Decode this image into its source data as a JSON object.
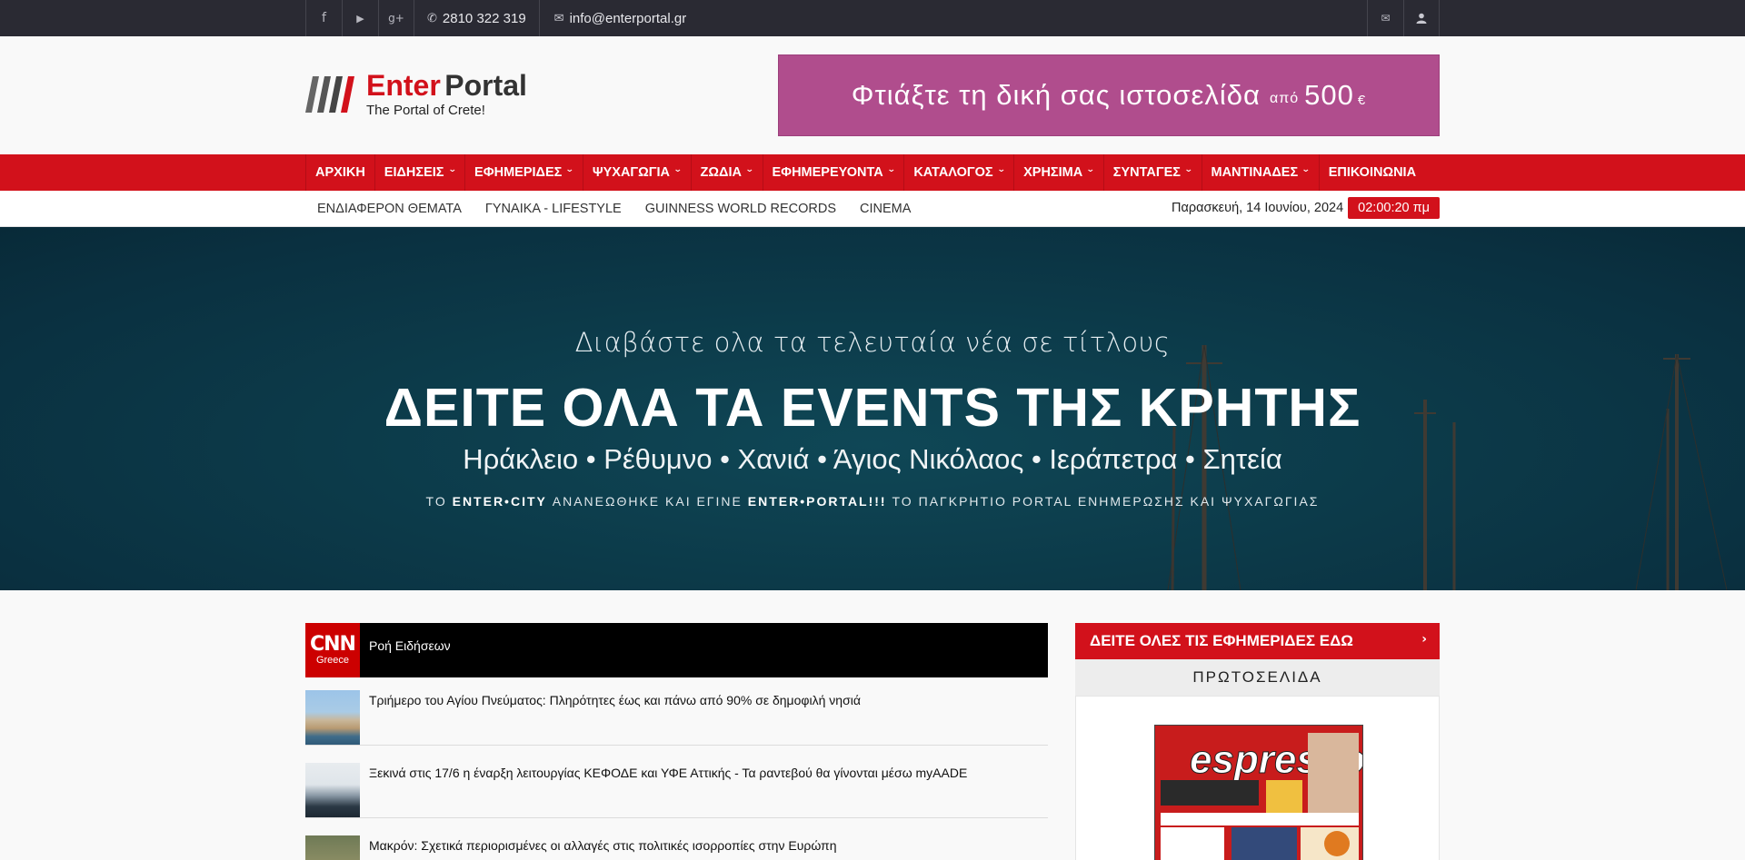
{
  "topbar": {
    "social_icons": [
      "facebook-icon",
      "youtube-icon",
      "google-plus-icon"
    ],
    "social_glyphs": [
      "f",
      "▶",
      "g+"
    ],
    "phone_glyph": "✆",
    "phone": "2810 322 319",
    "email_glyph": "✉",
    "email": "info@enterportal.gr",
    "right_icons": [
      "envelope-icon",
      "user-icon"
    ],
    "right_glyphs": [
      "✉",
      "👤"
    ]
  },
  "logo": {
    "enter": "Enter",
    "portal": "Portal",
    "tagline": "The Portal of Crete!"
  },
  "banner": {
    "text": "Φτιάξτε τη δική σας ιστοσελίδα",
    "from": "από",
    "price": "500",
    "currency": "€"
  },
  "mainnav": {
    "items": [
      {
        "label": "ΑΡΧΙΚΗ",
        "dropdown": false
      },
      {
        "label": "ΕΙΔΗΣΕΙΣ",
        "dropdown": true
      },
      {
        "label": "ΕΦΗΜΕΡΙΔΕΣ",
        "dropdown": true
      },
      {
        "label": "ΨΥΧΑΓΩΓΙΑ",
        "dropdown": true
      },
      {
        "label": "ΖΩΔΙΑ",
        "dropdown": true
      },
      {
        "label": "ΕΦΗΜΕΡΕΥΟΝΤΑ",
        "dropdown": true
      },
      {
        "label": "ΚΑΤΑΛΟΓΟΣ",
        "dropdown": true
      },
      {
        "label": "ΧΡΗΣΙΜΑ",
        "dropdown": true
      },
      {
        "label": "ΣΥΝΤΑΓΕΣ",
        "dropdown": true
      },
      {
        "label": "ΜΑΝΤΙΝΑΔΕΣ",
        "dropdown": true
      },
      {
        "label": "ΕΠΙΚΟΙΝΩΝΙΑ",
        "dropdown": false
      }
    ]
  },
  "subnav": {
    "items": [
      "ΕΝΔΙΑΦΕΡΟΝ ΘΕΜΑΤΑ",
      "ΓΥΝΑΙΚΑ - LIFESTYLE",
      "GUINNESS WORLD RECORDS",
      "CINEMA"
    ],
    "date": "Παρασκευή, 14 Ιουνίου, 2024",
    "time": "02:00:20 πμ"
  },
  "hero": {
    "subtitle": "Διαβάστε ολα τα τελευταία νέα σε τίτλους",
    "title": "ΔΕΙΤΕ ΟΛΑ ΤΑ EVENTS ΤΗΣ ΚΡΗΤΗΣ",
    "cities": "Ηράκλειο • Ρέθυμνο • Χανιά • Άγιος Νικόλαος • Ιεράπετρα • Σητεία",
    "note_prefix": "ΤΟ ",
    "note_b1": "ENTER•CITY",
    "note_mid": " ΑΝΑΝΕΩΘΗΚΕ ΚΑΙ ΕΓΙΝΕ ",
    "note_b2": "ENTER•PORTAL!!!",
    "note_suffix": " ΤΟ ΠΑΓΚΡΗΤΙΟ PORTAL ΕΝΗΜΕΡΩΣΗΣ ΚΑΙ ΨΥΧΑΓΩΓΙΑΣ"
  },
  "feed": {
    "source_logo": "CNN",
    "source_sub": "Greece",
    "title": "Ροή Ειδήσεων",
    "items": [
      {
        "text": "Τριήμερο του Αγίου Πνεύματος: Πληρότητες έως και πάνω από 90% σε δημοφιλή νησιά"
      },
      {
        "text": "Ξεκινά στις 17/6 η έναρξη λειτουργίας ΚΕΦΟΔΕ και ΥΦΕ Αττικής - Τα ραντεβού θα γίνονται μέσω myAADE"
      },
      {
        "text": "Μακρόν: Σχετικά περιορισμένες οι αλλαγές στις πολιτικές ισορροπίες στην Ευρώπη"
      }
    ]
  },
  "sidebar": {
    "button": "ΔΕΙΤΕ ΟΛΕΣ ΤΙΣ ΕΦΗΜΕΡΙΔΕΣ ΕΔΩ",
    "button_arrow": "›",
    "heading": "ΠΡΩΤΟΣΕΛΙΔΑ",
    "newspaper_name": "espresso"
  },
  "colors": {
    "brand_red": "#d2111b",
    "topbar": "#2a2a33",
    "banner": "#b04d8d",
    "hero": "#0c3a49"
  }
}
